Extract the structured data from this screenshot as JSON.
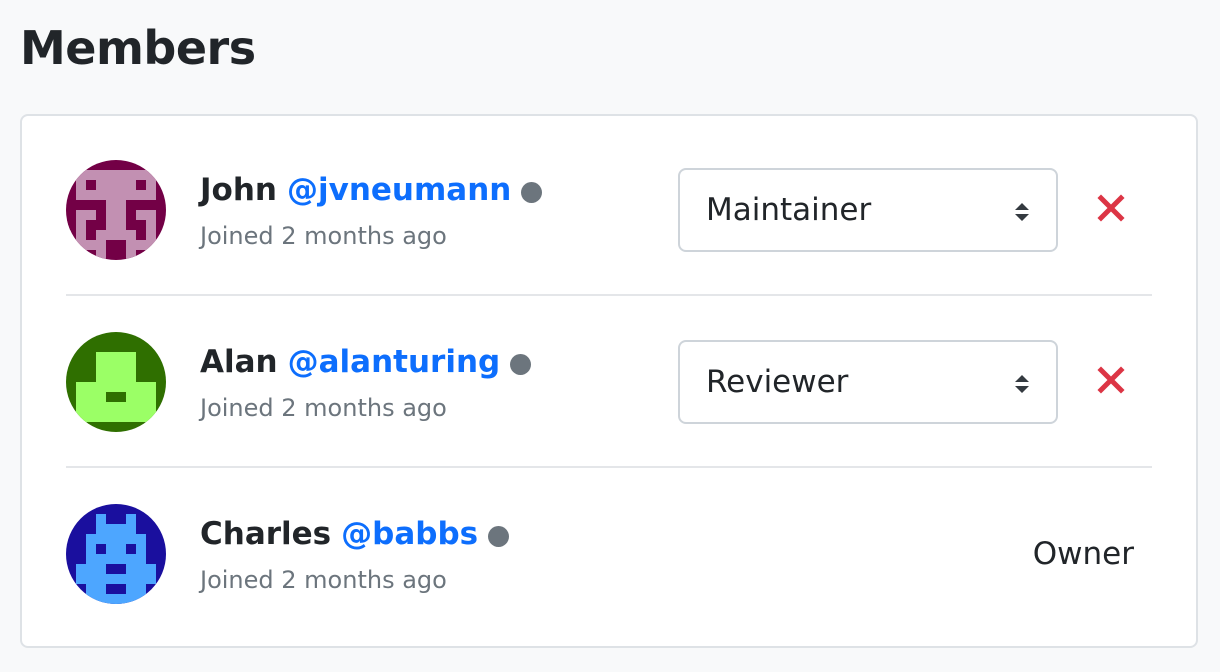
{
  "page": {
    "title": "Members"
  },
  "colors": {
    "accent": "#0d6efd",
    "danger": "#dc3545",
    "muted": "#6c757d"
  },
  "members": [
    {
      "display_name": "John",
      "handle": "@jvneumann",
      "joined": "Joined 2 months ago",
      "role": "Maintainer",
      "avatar_icon": "identicon-avatar",
      "remove_icon": "close-icon"
    },
    {
      "display_name": "Alan",
      "handle": "@alanturing",
      "joined": "Joined 2 months ago",
      "role": "Reviewer",
      "avatar_icon": "identicon-avatar",
      "remove_icon": "close-icon"
    },
    {
      "display_name": "Charles",
      "handle": "@babbs",
      "joined": "Joined 2 months ago",
      "role": "Owner",
      "avatar_icon": "identicon-avatar"
    }
  ]
}
